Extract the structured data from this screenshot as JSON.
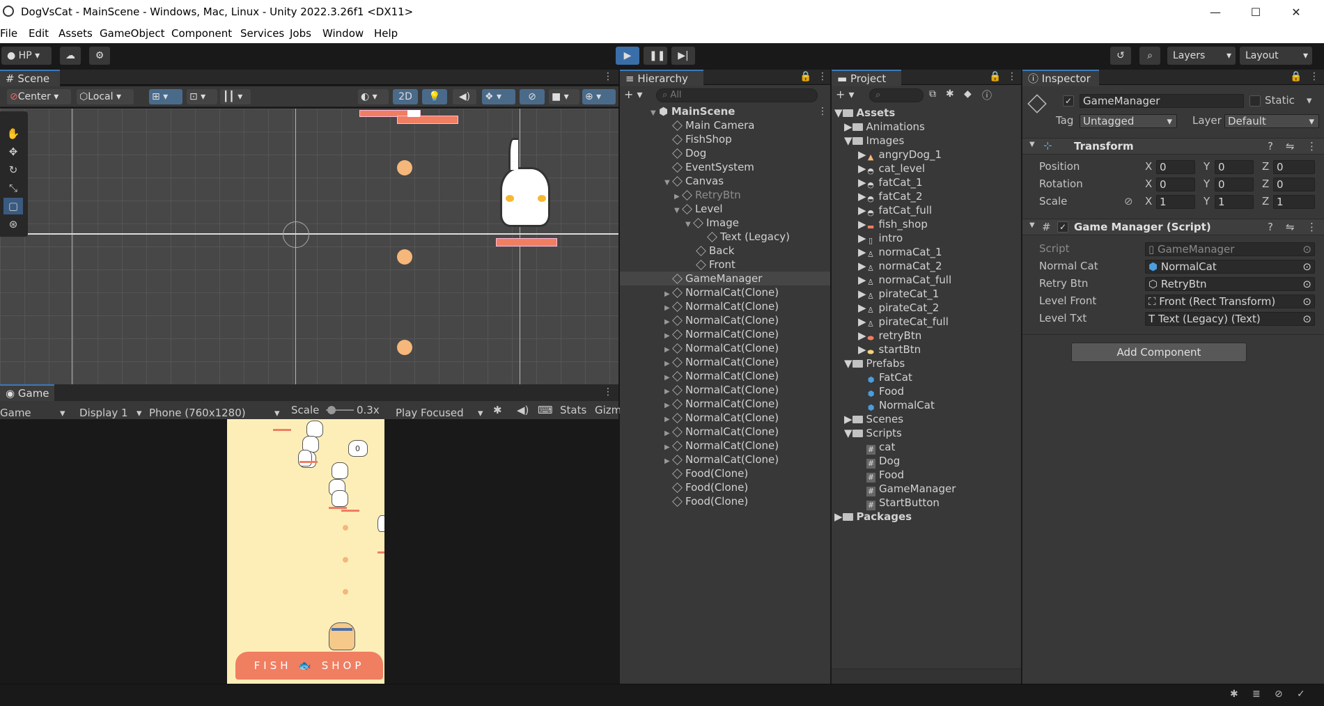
{
  "window": {
    "title": "DogVsCat - MainScene - Windows, Mac, Linux - Unity 2022.3.26f1 <DX11>"
  },
  "menu": [
    "File",
    "Edit",
    "Assets",
    "GameObject",
    "Component",
    "Services",
    "Jobs",
    "Window",
    "Help"
  ],
  "toolbar": {
    "account": "HP",
    "layers": "Layers",
    "layout": "Layout"
  },
  "scene": {
    "tab": "Scene",
    "pivot": "Center",
    "space": "Local",
    "mode2d": "2D"
  },
  "game": {
    "tab": "Game",
    "view": "Game",
    "display": "Display 1",
    "resolution": "Phone (760x1280)",
    "scale_label": "Scale",
    "scale_value": "0.3x",
    "play_focused": "Play Focused",
    "stats": "Stats",
    "gizmos": "Gizm",
    "counter": "0",
    "shop_text": "FISH 🐟 SHOP"
  },
  "hierarchy": {
    "tab": "Hierarchy",
    "search": "All",
    "scene_name": "MainScene",
    "rows": [
      "Main Camera",
      "FishShop",
      "Dog",
      "EventSystem",
      "Canvas",
      "RetryBtn",
      "Level",
      "Image",
      "Text (Legacy)",
      "Back",
      "Front",
      "GameManager",
      "NormalCat(Clone)",
      "NormalCat(Clone)",
      "NormalCat(Clone)",
      "NormalCat(Clone)",
      "NormalCat(Clone)",
      "NormalCat(Clone)",
      "NormalCat(Clone)",
      "NormalCat(Clone)",
      "NormalCat(Clone)",
      "NormalCat(Clone)",
      "NormalCat(Clone)",
      "NormalCat(Clone)",
      "NormalCat(Clone)",
      "Food(Clone)",
      "Food(Clone)",
      "Food(Clone)"
    ]
  },
  "project": {
    "tab": "Project",
    "rows": [
      "Assets",
      "Animations",
      "Images",
      "angryDog_1",
      "cat_level",
      "fatCat_1",
      "fatCat_2",
      "fatCat_full",
      "fish_shop",
      "intro",
      "normaCat_1",
      "normaCat_2",
      "normaCat_full",
      "pirateCat_1",
      "pirateCat_2",
      "pirateCat_full",
      "retryBtn",
      "startBtn",
      "Prefabs",
      "FatCat",
      "Food",
      "NormalCat",
      "Scenes",
      "Scripts",
      "cat",
      "Dog",
      "Food",
      "GameManager",
      "StartButton",
      "Packages"
    ]
  },
  "inspector": {
    "tab": "Inspector",
    "object_name": "GameManager",
    "static_label": "Static",
    "tag_label": "Tag",
    "tag_value": "Untagged",
    "layer_label": "Layer",
    "layer_value": "Default",
    "transform": {
      "title": "Transform",
      "position_label": "Position",
      "rotation_label": "Rotation",
      "scale_label": "Scale",
      "x": "X",
      "y": "Y",
      "z": "Z",
      "position": [
        "0",
        "0",
        "0"
      ],
      "rotation": [
        "0",
        "0",
        "0"
      ],
      "scale": [
        "1",
        "1",
        "1"
      ]
    },
    "script": {
      "title": "Game Manager (Script)",
      "fields": [
        {
          "label": "Script",
          "value": "GameManager"
        },
        {
          "label": "Normal Cat",
          "value": "NormalCat"
        },
        {
          "label": "Retry Btn",
          "value": "RetryBtn"
        },
        {
          "label": "Level Front",
          "value": "Front (Rect Transform)"
        },
        {
          "label": "Level Txt",
          "value": "Text (Legacy) (Text)"
        }
      ]
    },
    "add_component": "Add Component"
  }
}
